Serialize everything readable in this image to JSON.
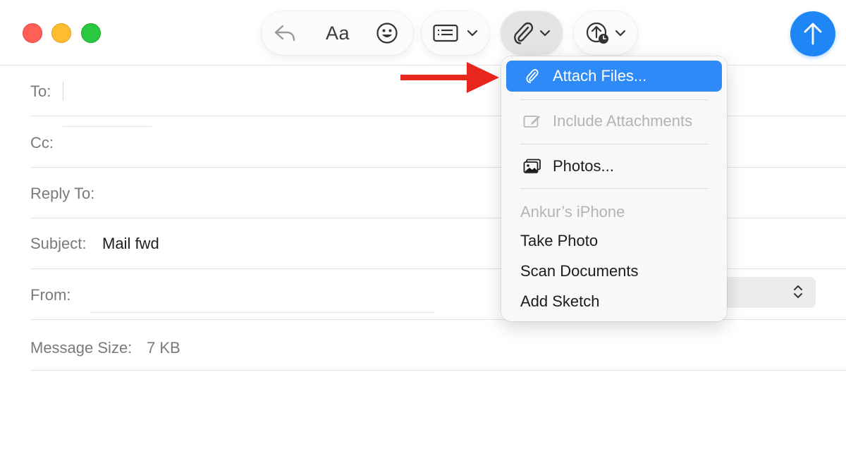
{
  "window": {
    "controls": [
      "close",
      "minimize",
      "zoom"
    ]
  },
  "toolbar": {
    "reply_icon": "reply-arrow-icon",
    "format_label": "Aa",
    "emoji_icon": "smiley-icon",
    "header_fields_icon": "header-fields-icon",
    "attach_icon": "paperclip-icon",
    "send_later_icon": "send-later-icon",
    "send_icon": "arrow-up-icon"
  },
  "fields": {
    "to_label": "To:",
    "cc_label": "Cc:",
    "reply_to_label": "Reply To:",
    "subject_label": "Subject:",
    "subject_value": "Mail fwd",
    "from_label": "From:",
    "message_size_label": "Message Size:",
    "message_size_value": "7 KB"
  },
  "attach_menu": {
    "attach_files": "Attach Files...",
    "include_attachments": "Include Attachments",
    "photos": "Photos...",
    "device_section": "Ankur’s iPhone",
    "take_photo": "Take Photo",
    "scan_documents": "Scan Documents",
    "add_sketch": "Add Sketch"
  },
  "colors": {
    "accent": "#2e8af6",
    "send_button": "#1f87f5",
    "annotation_arrow": "#e8261e"
  }
}
